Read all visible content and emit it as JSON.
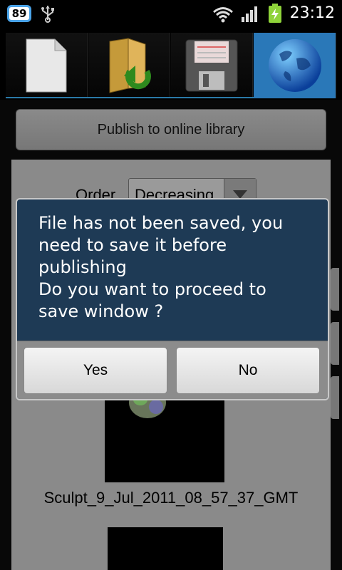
{
  "status_bar": {
    "notification_count": "89",
    "time": "23:12",
    "icons": [
      "usb-icon",
      "wifi-icon",
      "signal-icon",
      "battery-charging-icon"
    ]
  },
  "toolbar": {
    "buttons": [
      {
        "name": "new-file",
        "icon": "document-icon"
      },
      {
        "name": "open-file",
        "icon": "folder-open-icon"
      },
      {
        "name": "save-file",
        "icon": "floppy-disk-icon"
      },
      {
        "name": "online",
        "icon": "globe-icon",
        "selected": true
      }
    ]
  },
  "main": {
    "publish_label": "Publish to online library",
    "order_label": "Order",
    "order_value": "Decreasing",
    "items": [
      {
        "name": "Sculpt_9_Jul_2011_08_57_37_GMT"
      }
    ]
  },
  "dialog": {
    "message": "File has not been saved, you\nneed to save it before\npublishing\nDo you want to proceed to\nsave window ?",
    "yes_label": "Yes",
    "no_label": "No"
  },
  "colors": {
    "dialog_bg": "#1e3a55",
    "selected_tab": "#2a78b8",
    "panel_bg": "#8a8a8a"
  }
}
